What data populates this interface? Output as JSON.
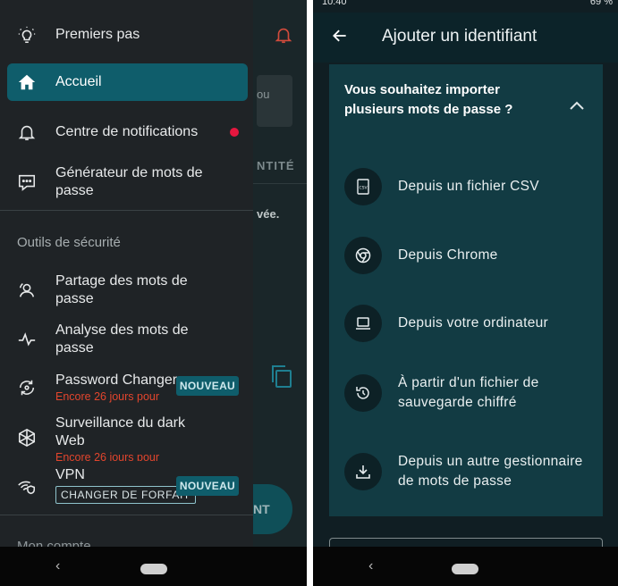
{
  "left": {
    "status_time": "",
    "menu": {
      "items": [
        {
          "label": "Premiers pas",
          "icon": "lightbulb-icon"
        },
        {
          "label": "Accueil",
          "icon": "home-icon",
          "active": true
        },
        {
          "label": "Centre de notifications",
          "icon": "bell-icon",
          "dot_color": "#e5173f"
        },
        {
          "label": "Générateur de mots de passe",
          "icon": "password-generator-icon"
        }
      ],
      "security_title": "Outils de sécurité",
      "security_items": [
        {
          "label": "Partage des mots de passe",
          "icon": "share-user-icon"
        },
        {
          "label": "Analyse des mots de passe",
          "icon": "pulse-icon"
        },
        {
          "label": "Password Changer",
          "icon": "refresh-icon",
          "sub": "Encore 26 jours pour",
          "badge": "NOUVEAU"
        },
        {
          "label": "Surveillance du dark Web",
          "icon": "darkweb-icon",
          "sub": "Encore 26 jours pour"
        },
        {
          "label": "VPN",
          "icon": "wifi-shield-icon",
          "button": "CHANGER DE FORFAIT",
          "badge": "NOUVEAU"
        }
      ],
      "account_title": "Mon compte"
    },
    "background": {
      "card_text": "ou",
      "header_text": "NTITÉ",
      "body_text": "vée.",
      "button_text": "NT"
    },
    "nav": {
      "back": "‹"
    }
  },
  "right": {
    "status_time": "10:40",
    "status_battery": "69 %",
    "appbar_title": "Ajouter un identifiant",
    "card": {
      "title": "Vous souhaitez importer plusieurs mots de passe ?",
      "options": [
        {
          "label": "Depuis un fichier CSV",
          "icon": "csv-file-icon"
        },
        {
          "label": "Depuis Chrome",
          "icon": "chrome-icon"
        },
        {
          "label": "Depuis votre ordinateur",
          "icon": "laptop-icon"
        },
        {
          "label": "À partir d'un fichier de sauvegarde chiffré",
          "icon": "restore-icon"
        },
        {
          "label": "Depuis un autre gestionnaire de mots de passe",
          "icon": "download-icon"
        }
      ]
    },
    "nav": {
      "back": "‹"
    }
  },
  "colors": {
    "accent": "#0f5d6b",
    "alert": "#e2452d",
    "card": "#123b43"
  }
}
